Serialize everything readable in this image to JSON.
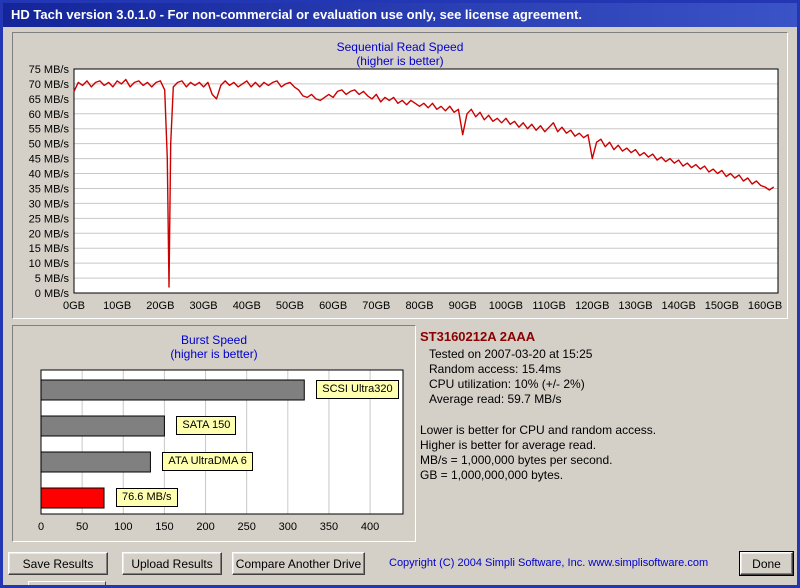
{
  "titlebar": {
    "title": "HD Tach version 3.0.1.0  - For non-commercial or evaluation use only, see license agreement."
  },
  "colors": {
    "titlebar_start": "#14259a",
    "titlebar_end": "#3a53c6",
    "chart_title": "#0000cc",
    "line": "#cc0000",
    "bar_gray": "#808080",
    "bar_red": "#ff0000",
    "label_bg": "#ffffb0",
    "drive_name": "#8b0000",
    "copyright": "#0000cc",
    "gridline": "#c8c8c8"
  },
  "chart_data": [
    {
      "type": "line",
      "title": "Sequential Read Speed",
      "subtitle": "(higher is better)",
      "x_unit": "GB",
      "y_unit": "MB/s",
      "xlim": [
        0,
        163
      ],
      "ylim": [
        0,
        75
      ],
      "grid": "horizontal",
      "y_ticks": [
        {
          "value": 75,
          "label": "75 MB/s"
        },
        {
          "value": 70,
          "label": "70 MB/s"
        },
        {
          "value": 65,
          "label": "65 MB/s"
        },
        {
          "value": 60,
          "label": "60 MB/s"
        },
        {
          "value": 55,
          "label": "55 MB/s"
        },
        {
          "value": 50,
          "label": "50 MB/s"
        },
        {
          "value": 45,
          "label": "45 MB/s"
        },
        {
          "value": 40,
          "label": "40 MB/s"
        },
        {
          "value": 35,
          "label": "35 MB/s"
        },
        {
          "value": 30,
          "label": "30 MB/s"
        },
        {
          "value": 25,
          "label": "25 MB/s"
        },
        {
          "value": 20,
          "label": "20 MB/s"
        },
        {
          "value": 15,
          "label": "15 MB/s"
        },
        {
          "value": 10,
          "label": "10 MB/s"
        },
        {
          "value": 5,
          "label": "5 MB/s"
        },
        {
          "value": 0,
          "label": "0 MB/s"
        }
      ],
      "x_ticks": [
        {
          "value": 0,
          "label": "0GB"
        },
        {
          "value": 10,
          "label": "10GB"
        },
        {
          "value": 20,
          "label": "20GB"
        },
        {
          "value": 30,
          "label": "30GB"
        },
        {
          "value": 40,
          "label": "40GB"
        },
        {
          "value": 50,
          "label": "50GB"
        },
        {
          "value": 60,
          "label": "60GB"
        },
        {
          "value": 70,
          "label": "70GB"
        },
        {
          "value": 80,
          "label": "80GB"
        },
        {
          "value": 90,
          "label": "90GB"
        },
        {
          "value": 100,
          "label": "100GB"
        },
        {
          "value": 110,
          "label": "110GB"
        },
        {
          "value": 120,
          "label": "120GB"
        },
        {
          "value": 130,
          "label": "130GB"
        },
        {
          "value": 140,
          "label": "140GB"
        },
        {
          "value": 150,
          "label": "150GB"
        },
        {
          "value": 160,
          "label": "160GB"
        }
      ],
      "series": [
        {
          "name": "Sequential read speed",
          "color": "#cc0000",
          "points": [
            [
              0,
              67.5
            ],
            [
              1,
              70.5
            ],
            [
              2,
              69.5
            ],
            [
              3,
              71
            ],
            [
              4,
              69
            ],
            [
              5,
              70.5
            ],
            [
              6,
              71
            ],
            [
              7,
              69.5
            ],
            [
              8,
              70.5
            ],
            [
              9,
              69
            ],
            [
              10,
              71
            ],
            [
              11,
              70
            ],
            [
              12,
              71.5
            ],
            [
              13,
              69
            ],
            [
              14,
              70.5
            ],
            [
              15,
              71
            ],
            [
              16,
              69.5
            ],
            [
              17,
              70.5
            ],
            [
              18,
              69
            ],
            [
              19,
              70.5
            ],
            [
              20,
              71
            ],
            [
              21,
              68
            ],
            [
              21.6,
              45
            ],
            [
              22,
              2
            ],
            [
              22.4,
              50
            ],
            [
              23,
              69
            ],
            [
              24,
              70.5
            ],
            [
              25,
              71
            ],
            [
              26,
              69
            ],
            [
              27,
              70.5
            ],
            [
              28,
              69.5
            ],
            [
              29,
              70.5
            ],
            [
              30,
              69
            ],
            [
              31,
              70.5
            ],
            [
              32,
              66.5
            ],
            [
              33,
              65
            ],
            [
              34,
              69.5
            ],
            [
              35,
              71
            ],
            [
              36,
              69.5
            ],
            [
              37,
              70.5
            ],
            [
              38,
              69
            ],
            [
              39,
              70
            ],
            [
              40,
              71
            ],
            [
              41,
              69
            ],
            [
              42,
              70.5
            ],
            [
              43,
              69
            ],
            [
              44,
              70.5
            ],
            [
              45,
              69.5
            ],
            [
              46,
              70.5
            ],
            [
              47,
              71
            ],
            [
              48,
              69
            ],
            [
              49,
              70
            ],
            [
              50,
              70.5
            ],
            [
              51,
              69
            ],
            [
              52,
              68
            ],
            [
              53,
              66
            ],
            [
              54,
              65.5
            ],
            [
              55,
              66.5
            ],
            [
              56,
              65
            ],
            [
              57,
              64.5
            ],
            [
              58,
              65.5
            ],
            [
              59,
              66.5
            ],
            [
              60,
              65.5
            ],
            [
              61,
              67.5
            ],
            [
              62,
              68
            ],
            [
              63,
              66.5
            ],
            [
              64,
              67.5
            ],
            [
              65,
              68
            ],
            [
              66,
              66.5
            ],
            [
              67,
              67.5
            ],
            [
              68,
              66
            ],
            [
              69,
              65
            ],
            [
              70,
              66.5
            ],
            [
              71,
              64
            ],
            [
              72,
              65.5
            ],
            [
              73,
              64.5
            ],
            [
              74,
              65.5
            ],
            [
              75,
              63.5
            ],
            [
              76,
              64.5
            ],
            [
              77,
              63
            ],
            [
              78,
              64.5
            ],
            [
              79,
              63.5
            ],
            [
              80,
              62.5
            ],
            [
              81,
              63.5
            ],
            [
              82,
              62
            ],
            [
              83,
              63.5
            ],
            [
              84,
              61.5
            ],
            [
              85,
              62.5
            ],
            [
              86,
              61
            ],
            [
              87,
              62.5
            ],
            [
              88,
              60.5
            ],
            [
              89,
              61.5
            ],
            [
              90,
              53
            ],
            [
              91,
              60
            ],
            [
              92,
              61.5
            ],
            [
              93,
              59
            ],
            [
              94,
              60.5
            ],
            [
              95,
              58
            ],
            [
              96,
              59.5
            ],
            [
              97,
              57.5
            ],
            [
              98,
              58.5
            ],
            [
              99,
              57
            ],
            [
              100,
              58.5
            ],
            [
              101,
              56.5
            ],
            [
              102,
              57.5
            ],
            [
              103,
              55.5
            ],
            [
              104,
              57
            ],
            [
              105,
              55
            ],
            [
              106,
              56.5
            ],
            [
              107,
              54.5
            ],
            [
              108,
              56
            ],
            [
              109,
              54
            ],
            [
              110,
              55.5
            ],
            [
              111,
              57
            ],
            [
              112,
              54
            ],
            [
              113,
              55.5
            ],
            [
              114,
              53.5
            ],
            [
              115,
              54.5
            ],
            [
              116,
              52.5
            ],
            [
              117,
              53.5
            ],
            [
              118,
              52
            ],
            [
              119,
              53
            ],
            [
              120,
              45
            ],
            [
              121,
              50.5
            ],
            [
              122,
              51.5
            ],
            [
              123,
              49
            ],
            [
              124,
              50.5
            ],
            [
              125,
              48
            ],
            [
              126,
              49.5
            ],
            [
              127,
              47.5
            ],
            [
              128,
              48.5
            ],
            [
              129,
              47
            ],
            [
              130,
              48
            ],
            [
              131,
              46
            ],
            [
              132,
              47
            ],
            [
              133,
              45.5
            ],
            [
              134,
              46.5
            ],
            [
              135,
              44.5
            ],
            [
              136,
              45.5
            ],
            [
              137,
              44
            ],
            [
              138,
              45
            ],
            [
              139,
              43.5
            ],
            [
              140,
              44.5
            ],
            [
              141,
              42.5
            ],
            [
              142,
              43.5
            ],
            [
              143,
              42
            ],
            [
              144,
              43
            ],
            [
              145,
              41.5
            ],
            [
              146,
              42.5
            ],
            [
              147,
              40.5
            ],
            [
              148,
              41.5
            ],
            [
              149,
              40
            ],
            [
              150,
              41
            ],
            [
              151,
              39
            ],
            [
              152,
              40
            ],
            [
              153,
              38.5
            ],
            [
              154,
              39.5
            ],
            [
              155,
              37.5
            ],
            [
              156,
              38.5
            ],
            [
              157,
              36.5
            ],
            [
              158,
              37.5
            ],
            [
              159,
              36
            ],
            [
              160,
              35.5
            ],
            [
              161,
              34.5
            ],
            [
              162,
              35.5
            ]
          ]
        }
      ]
    },
    {
      "type": "bar",
      "orientation": "horizontal",
      "title": "Burst Speed",
      "subtitle": "(higher is better)",
      "xlim": [
        0,
        440
      ],
      "grid": "vertical",
      "x_ticks": [
        0,
        50,
        100,
        150,
        200,
        250,
        300,
        350,
        400
      ],
      "bars": [
        {
          "label": "SCSI Ultra320",
          "value": 320,
          "color": "#808080"
        },
        {
          "label": "SATA 150",
          "value": 150,
          "color": "#808080"
        },
        {
          "label": "ATA UltraDMA 6",
          "value": 133,
          "color": "#808080"
        },
        {
          "label": "76.6 MB/s",
          "value": 76.6,
          "color": "#ff0000"
        }
      ]
    }
  ],
  "info": {
    "drive": "ST3160212A 2AAA",
    "lines": [
      "Tested on 2007-03-20 at 15:25",
      "Random access: 15.4ms",
      "CPU utilization: 10% (+/- 2%)",
      "Average read: 59.7 MB/s"
    ],
    "notes": [
      "Lower is better for CPU and random access.",
      "Higher is better for average read.",
      "MB/s = 1,000,000 bytes per second.",
      "GB = 1,000,000,000 bytes."
    ]
  },
  "footer": {
    "save_label": "Save Results",
    "upload_label": "Upload Results",
    "compare_label": "Compare Another Drive",
    "done_label": "Done",
    "copyright": "Copyright (C) 2004 Simpli Software, Inc. www.simplisoftware.com"
  }
}
